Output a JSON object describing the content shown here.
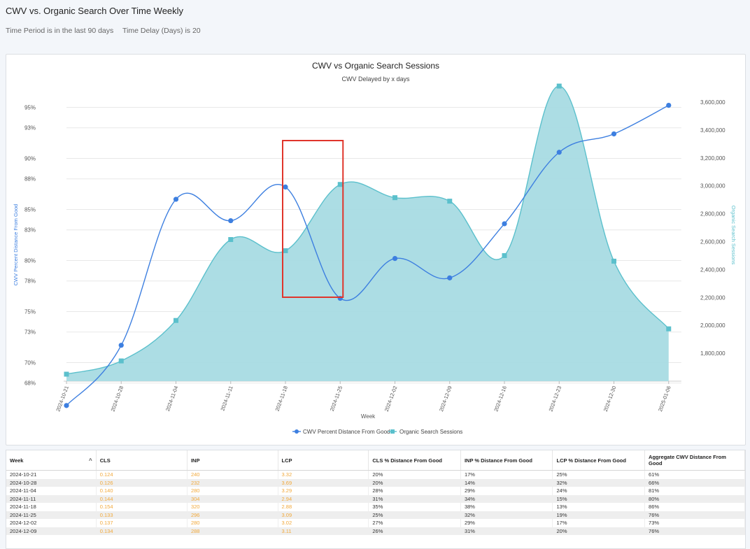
{
  "page": {
    "title": "CWV vs. Organic Search Over Time Weekly",
    "filters": [
      "Time Period is in the last 90 days",
      "Time Delay (Days) is 20"
    ]
  },
  "chart_data": {
    "type": "line+area",
    "title": "CWV vs Organic Search Sessions",
    "subtitle": "CWV Delayed by x days",
    "xlabel": "Week",
    "ylabel_left": "CWV Percent Distance From Good",
    "ylabel_right": "Organic Search Sessions",
    "categories": [
      "2024-10-21",
      "2024-10-28",
      "2024-11-04",
      "2024-11-11",
      "2024-11-18",
      "2024-11-25",
      "2024-12-02",
      "2024-12-09",
      "2024-12-16",
      "2024-12-23",
      "2024-12-30",
      "2025-01-06"
    ],
    "left_ticks": [
      "95%",
      "93%",
      "90%",
      "88%",
      "85%",
      "83%",
      "80%",
      "78%",
      "75%",
      "73%",
      "70%",
      "68%"
    ],
    "right_ticks": [
      "3,600,000",
      "3,400,000",
      "3,200,000",
      "3,000,000",
      "2,800,000",
      "2,600,000",
      "2,400,000",
      "2,200,000",
      "2,000,000",
      "1,800,000"
    ],
    "series": [
      {
        "name": "CWV Percent Distance From Good",
        "axis": "left",
        "color": "#3d7fe0",
        "marker": "circle",
        "values": [
          65.8,
          71.7,
          86.0,
          83.9,
          87.2,
          76.3,
          80.2,
          78.3,
          83.6,
          90.6,
          92.4,
          95.2
        ]
      },
      {
        "name": "Organic Search Sessions",
        "axis": "right",
        "color": "#5bc0cc",
        "marker": "square",
        "values": [
          1650000,
          1745000,
          2035000,
          2615000,
          2535000,
          3010000,
          2915000,
          2890000,
          2500000,
          3715000,
          2460000,
          1975000
        ]
      }
    ],
    "left_ylim": [
      65.5,
      96.2
    ],
    "right_ylim": [
      1600000,
      3780000
    ],
    "legend_position": "bottom",
    "highlight": {
      "from_category": "2024-11-18",
      "to_category": "2024-11-25",
      "color": "#e0352b"
    }
  },
  "table": {
    "columns": [
      "Week",
      "CLS",
      "INP",
      "LCP",
      "CLS % Distance From Good",
      "INP % Distance From Good",
      "LCP % Distance From Good",
      "Aggregate CWV Distance From Good"
    ],
    "rows": [
      [
        "2024-10-21",
        "0.124",
        "240",
        "3.32",
        "20%",
        "17%",
        "25%",
        "61%"
      ],
      [
        "2024-10-28",
        "0.126",
        "232",
        "3.69",
        "20%",
        "14%",
        "32%",
        "66%"
      ],
      [
        "2024-11-04",
        "0.140",
        "280",
        "3.29",
        "28%",
        "29%",
        "24%",
        "81%"
      ],
      [
        "2024-11-11",
        "0.144",
        "304",
        "2.94",
        "31%",
        "34%",
        "15%",
        "80%"
      ],
      [
        "2024-11-18",
        "0.154",
        "320",
        "2.88",
        "35%",
        "38%",
        "13%",
        "86%"
      ],
      [
        "2024-11-25",
        "0.133",
        "296",
        "3.09",
        "25%",
        "32%",
        "19%",
        "76%"
      ],
      [
        "2024-12-02",
        "0.137",
        "280",
        "3.02",
        "27%",
        "29%",
        "17%",
        "73%"
      ],
      [
        "2024-12-09",
        "0.134",
        "288",
        "3.11",
        "26%",
        "31%",
        "20%",
        "76%"
      ]
    ]
  }
}
